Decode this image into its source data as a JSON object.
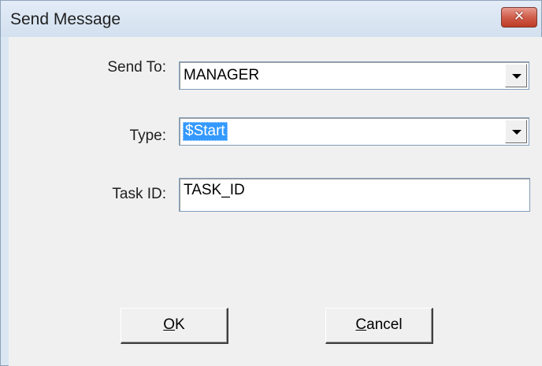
{
  "window": {
    "title": "Send Message",
    "close_glyph": "✕",
    "close_icon": "close-icon"
  },
  "form": {
    "send_to": {
      "label": "Send To:",
      "value": "MANAGER"
    },
    "type": {
      "label": "Type:",
      "value": "$Start",
      "selected": true
    },
    "task_id": {
      "label": "Task ID:",
      "value": "TASK_ID"
    }
  },
  "buttons": {
    "ok": {
      "mnemonic": "O",
      "rest": "K"
    },
    "cancel": {
      "mnemonic": "C",
      "rest": "ancel"
    }
  },
  "colors": {
    "selection": "#3399ff",
    "close_button": "#c7432e"
  }
}
